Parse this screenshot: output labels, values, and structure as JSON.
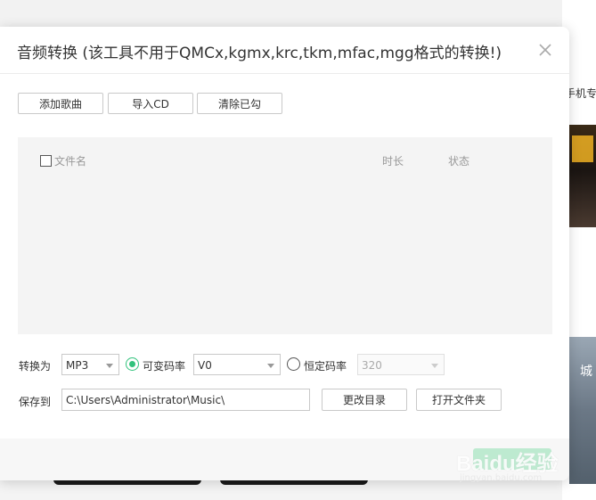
{
  "background": {
    "right_text": "手机专",
    "thumb_text": "城"
  },
  "dialog": {
    "title": "音频转换 (该工具不用于QMCx,kgmx,krc,tkm,mfac,mgg格式的转换!)",
    "toolbar": {
      "add_song": "添加歌曲",
      "import_cd": "导入CD",
      "clear_checked": "清除已勾"
    },
    "list": {
      "col_filename": "文件名",
      "col_duration": "时长",
      "col_status": "状态",
      "rows": []
    },
    "convert": {
      "label": "转换为",
      "format": "MP3",
      "vbr_label": "可变码率",
      "vbr_value": "V0",
      "cbr_label": "恒定码率",
      "cbr_value": "320",
      "mode": "vbr"
    },
    "save": {
      "label": "保存到",
      "path": "C:\\Users\\Administrator\\Music\\",
      "change_dir": "更改目录",
      "open_folder": "打开文件夹"
    }
  },
  "watermark": {
    "text": "Baidu经验",
    "url": "jingyan.baidu.com"
  },
  "colors": {
    "accent": "#31c27c"
  }
}
